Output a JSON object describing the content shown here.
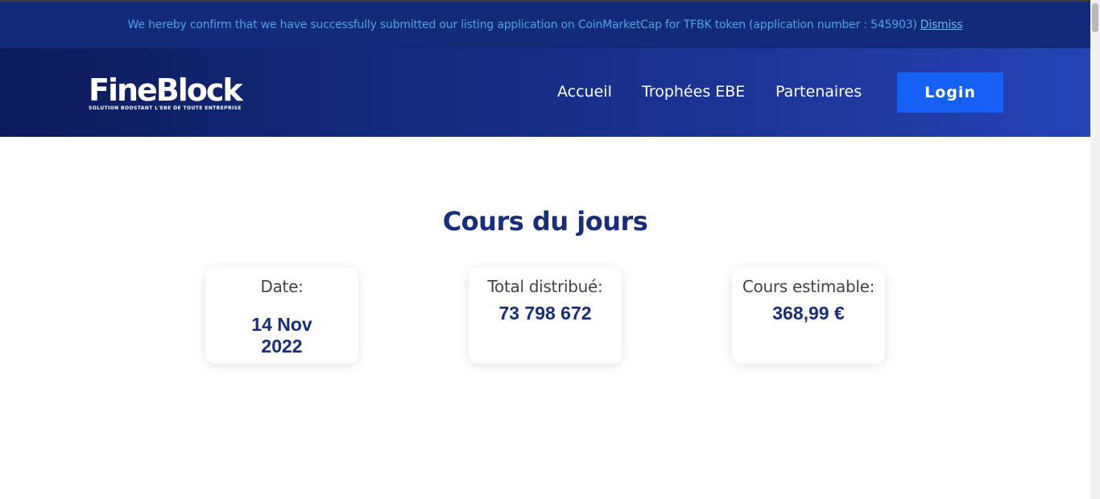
{
  "notice": {
    "message": "We hereby confirm that we have successfully submitted our listing application on CoinMarketCap for TFBK token (application number : 545903)",
    "dismiss_label": "Dismiss"
  },
  "header": {
    "logo_text": "FineBlock",
    "logo_tagline": "SOLUTION BOOSTANT L'EBE DE TOUTE ENTREPRISE",
    "nav": [
      "Accueil",
      "Trophées EBE",
      "Partenaires"
    ],
    "login_label": "Login"
  },
  "main": {
    "title": "Cours du jours",
    "cards": [
      {
        "label": "Date:",
        "value": "14 Nov 2022"
      },
      {
        "label": "Total distribué:",
        "value": "73 798 672"
      },
      {
        "label": "Cours estimable:",
        "value": "368,99 €"
      }
    ]
  },
  "colors": {
    "notice_bg": "#122a78",
    "header_gradient_start": "#0c1b5c",
    "header_gradient_end": "#2543b5",
    "accent": "#1660f5",
    "title": "#162e7c"
  }
}
